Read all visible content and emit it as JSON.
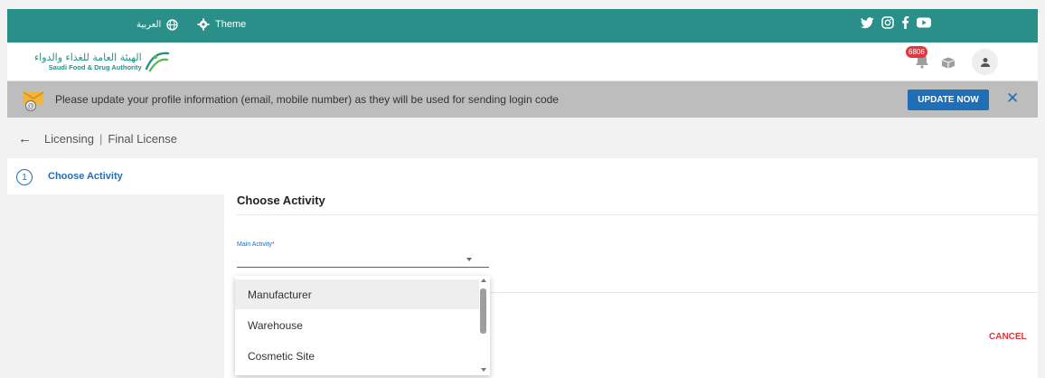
{
  "topbar": {
    "language_label": "العربية",
    "theme_label": "Theme",
    "social_icons": [
      "twitter-icon",
      "instagram-icon",
      "facebook-icon",
      "youtube-icon"
    ],
    "color": "#2a8f88"
  },
  "header": {
    "logo_ar": "الهيئة العامة للغذاء والدواء",
    "logo_en": "Saudi Food & Drug Authority",
    "notification_count": "6806"
  },
  "banner": {
    "message": "Please update your profile information (email, mobile number) as they will be used for sending login code",
    "update_label": "UPDATE NOW",
    "close_label": "✕"
  },
  "breadcrumb": {
    "back_label": "←",
    "parent": "Licensing",
    "separator": "|",
    "current": "Final License"
  },
  "sidebar": {
    "steps": [
      {
        "number": "1",
        "label": "Choose Activity"
      }
    ]
  },
  "main": {
    "title": "Choose Activity",
    "main_activity_label": "Main Activity",
    "required_mark": "*",
    "cancel_label": "CANCEL"
  },
  "dropdown": {
    "options": [
      "Manufacturer",
      "Warehouse",
      "Cosmetic Site"
    ],
    "highlighted_index": 0
  },
  "colors": {
    "accent": "#1f6fb7",
    "danger": "#e0363f",
    "brand": "#2a8f88"
  }
}
